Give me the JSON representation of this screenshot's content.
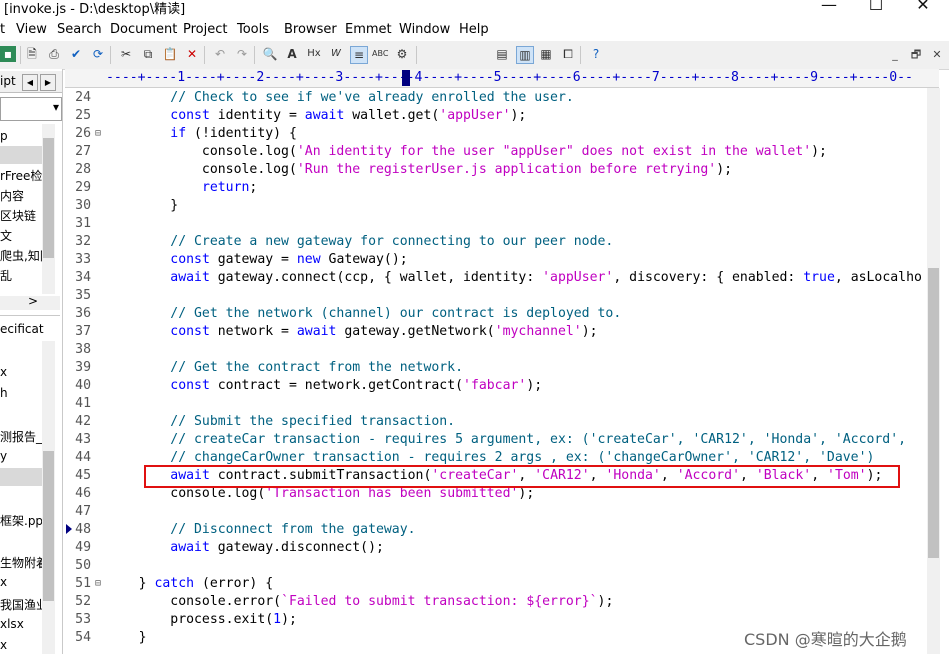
{
  "window": {
    "title": "[invoke.js - D:\\desktop\\精读]",
    "min": "—",
    "max": "☐",
    "close": "✕"
  },
  "menu": [
    "t",
    "View",
    "Search",
    "Document",
    "Project",
    "Tools",
    "Browser",
    "Emmet",
    "Window",
    "Help"
  ],
  "mdi": {
    "minimize": "_",
    "restore": "🗗",
    "close": "✕"
  },
  "sidebar": {
    "tab_label": "ipt",
    "tab_prev": "◀",
    "tab_next": "▶",
    "combo_arrow": "▾",
    "top_items": [
      "p",
      "",
      "rFree检",
      "内容",
      "区块链",
      "文",
      "爬虫,知网",
      "乱"
    ],
    "bottom_header": "ecificat",
    "bottom_items": [
      "",
      "x",
      "h",
      "",
      "",
      "测报告_",
      "y",
      "",
      "",
      "框架.pptx",
      "",
      "生物附着",
      "x",
      "我国渔业",
      "xlsx",
      "x"
    ],
    "scroll_right": ">"
  },
  "ruler": {
    "marks": "----+----1----+----2----+----3----+----4----+----5----+----6----+----7----+----8----+----9----+----0--"
  },
  "editor": {
    "lines": [
      {
        "n": "24",
        "fold": "",
        "tokens": [
          [
            "cm",
            "        // Check to see if we've already enrolled the user."
          ]
        ]
      },
      {
        "n": "25",
        "fold": "",
        "tokens": [
          [
            "",
            "        "
          ],
          [
            "kw",
            "const"
          ],
          [
            "",
            " identity = "
          ],
          [
            "kw",
            "await"
          ],
          [
            "",
            " wallet.get("
          ],
          [
            "str",
            "'appUser'"
          ],
          [
            "",
            ");"
          ]
        ]
      },
      {
        "n": "26",
        "fold": "⊟",
        "tokens": [
          [
            "",
            "        "
          ],
          [
            "kw",
            "if"
          ],
          [
            "",
            " (!identity) {"
          ]
        ]
      },
      {
        "n": "27",
        "fold": "",
        "tokens": [
          [
            "",
            "            console.log("
          ],
          [
            "str",
            "'An identity for the user \"appUser\" does not exist in the wallet'"
          ],
          [
            "",
            ");"
          ]
        ]
      },
      {
        "n": "28",
        "fold": "",
        "tokens": [
          [
            "",
            "            console.log("
          ],
          [
            "str",
            "'Run the registerUser.js application before retrying'"
          ],
          [
            "",
            ");"
          ]
        ]
      },
      {
        "n": "29",
        "fold": "",
        "tokens": [
          [
            "",
            "            "
          ],
          [
            "kw",
            "return"
          ],
          [
            "",
            ";"
          ]
        ]
      },
      {
        "n": "30",
        "fold": "",
        "tokens": [
          [
            "",
            "        }"
          ]
        ]
      },
      {
        "n": "31",
        "fold": "",
        "tokens": [
          [
            "",
            ""
          ]
        ]
      },
      {
        "n": "32",
        "fold": "",
        "tokens": [
          [
            "cm",
            "        // Create a new gateway for connecting to our peer node."
          ]
        ]
      },
      {
        "n": "33",
        "fold": "",
        "tokens": [
          [
            "",
            "        "
          ],
          [
            "kw",
            "const"
          ],
          [
            "",
            " gateway = "
          ],
          [
            "kw",
            "new"
          ],
          [
            "",
            " Gateway();"
          ]
        ]
      },
      {
        "n": "34",
        "fold": "",
        "tokens": [
          [
            "",
            "        "
          ],
          [
            "kw",
            "await"
          ],
          [
            "",
            " gateway.connect(ccp, { wallet, identity: "
          ],
          [
            "str",
            "'appUser'"
          ],
          [
            "",
            ", discovery: { enabled: "
          ],
          [
            "kw",
            "true"
          ],
          [
            "",
            ", asLocalho"
          ]
        ]
      },
      {
        "n": "35",
        "fold": "",
        "tokens": [
          [
            "",
            ""
          ]
        ]
      },
      {
        "n": "36",
        "fold": "",
        "tokens": [
          [
            "cm",
            "        // Get the network (channel) our contract is deployed to."
          ]
        ]
      },
      {
        "n": "37",
        "fold": "",
        "tokens": [
          [
            "",
            "        "
          ],
          [
            "kw",
            "const"
          ],
          [
            "",
            " network = "
          ],
          [
            "kw",
            "await"
          ],
          [
            "",
            " gateway.getNetwork("
          ],
          [
            "str",
            "'mychannel'"
          ],
          [
            "",
            ");"
          ]
        ]
      },
      {
        "n": "38",
        "fold": "",
        "tokens": [
          [
            "",
            ""
          ]
        ]
      },
      {
        "n": "39",
        "fold": "",
        "tokens": [
          [
            "cm",
            "        // Get the contract from the network."
          ]
        ]
      },
      {
        "n": "40",
        "fold": "",
        "tokens": [
          [
            "",
            "        "
          ],
          [
            "kw",
            "const"
          ],
          [
            "",
            " contract = network.getContract("
          ],
          [
            "str",
            "'fabcar'"
          ],
          [
            "",
            ");"
          ]
        ]
      },
      {
        "n": "41",
        "fold": "",
        "tokens": [
          [
            "",
            ""
          ]
        ]
      },
      {
        "n": "42",
        "fold": "",
        "tokens": [
          [
            "cm",
            "        // Submit the specified transaction."
          ]
        ]
      },
      {
        "n": "43",
        "fold": "",
        "tokens": [
          [
            "cm",
            "        // createCar transaction - requires 5 argument, ex: ('createCar', 'CAR12', 'Honda', 'Accord',"
          ]
        ]
      },
      {
        "n": "44",
        "fold": "",
        "tokens": [
          [
            "cm",
            "        // changeCarOwner transaction - requires 2 args , ex: ('changeCarOwner', 'CAR12', 'Dave')"
          ]
        ]
      },
      {
        "n": "45",
        "fold": "",
        "tokens": [
          [
            "",
            "        "
          ],
          [
            "kw",
            "await"
          ],
          [
            "",
            " contract.submitTransaction("
          ],
          [
            "str",
            "'createCar'"
          ],
          [
            "",
            ", "
          ],
          [
            "str",
            "'CAR12'"
          ],
          [
            "",
            ", "
          ],
          [
            "str",
            "'Honda'"
          ],
          [
            "",
            ", "
          ],
          [
            "str",
            "'Accord'"
          ],
          [
            "",
            ", "
          ],
          [
            "str",
            "'Black'"
          ],
          [
            "",
            ", "
          ],
          [
            "str",
            "'Tom'"
          ],
          [
            "",
            ");"
          ]
        ]
      },
      {
        "n": "46",
        "fold": "",
        "tokens": [
          [
            "",
            "        console.log("
          ],
          [
            "str",
            "'Transaction has been submitted'"
          ],
          [
            "",
            ");"
          ]
        ]
      },
      {
        "n": "47",
        "fold": "",
        "tokens": [
          [
            "",
            ""
          ]
        ]
      },
      {
        "n": "48",
        "fold": "",
        "tokens": [
          [
            "cm",
            "        // Disconnect from the gateway."
          ]
        ]
      },
      {
        "n": "49",
        "fold": "",
        "tokens": [
          [
            "",
            "        "
          ],
          [
            "kw",
            "await"
          ],
          [
            "",
            " gateway.disconnect();"
          ]
        ]
      },
      {
        "n": "50",
        "fold": "",
        "tokens": [
          [
            "",
            ""
          ]
        ]
      },
      {
        "n": "51",
        "fold": "⊟",
        "tokens": [
          [
            "",
            "    } "
          ],
          [
            "kw",
            "catch"
          ],
          [
            "",
            " (error) {"
          ]
        ]
      },
      {
        "n": "52",
        "fold": "",
        "tokens": [
          [
            "",
            "        console.error("
          ],
          [
            "str",
            "`Failed to submit transaction: ${error}`"
          ],
          [
            "",
            ");"
          ]
        ]
      },
      {
        "n": "53",
        "fold": "",
        "tokens": [
          [
            "",
            "        process.exit("
          ],
          [
            "kw",
            "1"
          ],
          [
            "",
            ");"
          ]
        ]
      },
      {
        "n": "54",
        "fold": "",
        "tokens": [
          [
            "",
            "    }"
          ]
        ]
      }
    ]
  },
  "watermark": "CSDN @寒暄的大企鹅",
  "colors": {
    "highlight_box": "#e01010",
    "keyword": "#0000ff",
    "string": "#c000c0",
    "comment": "#006080"
  }
}
